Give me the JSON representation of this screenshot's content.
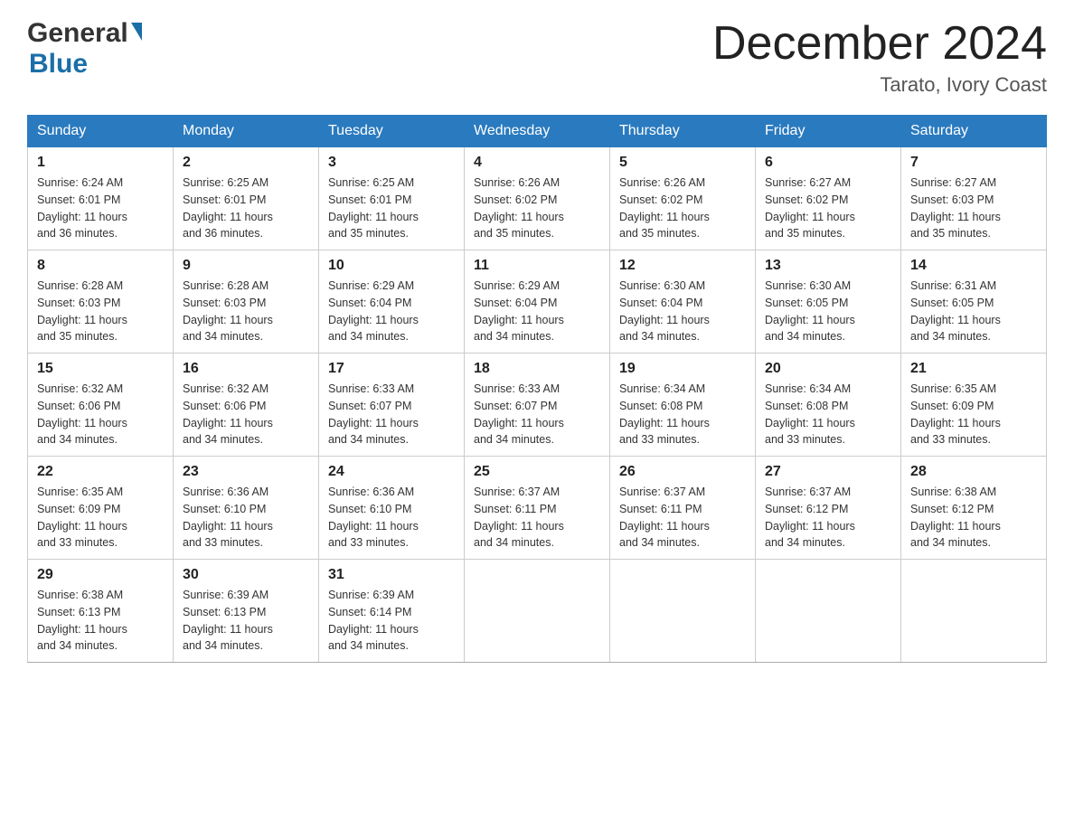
{
  "header": {
    "logo_general": "General",
    "logo_blue": "Blue",
    "month_title": "December 2024",
    "location": "Tarato, Ivory Coast"
  },
  "days_of_week": [
    "Sunday",
    "Monday",
    "Tuesday",
    "Wednesday",
    "Thursday",
    "Friday",
    "Saturday"
  ],
  "weeks": [
    [
      {
        "day": "1",
        "sunrise": "6:24 AM",
        "sunset": "6:01 PM",
        "daylight": "11 hours and 36 minutes."
      },
      {
        "day": "2",
        "sunrise": "6:25 AM",
        "sunset": "6:01 PM",
        "daylight": "11 hours and 36 minutes."
      },
      {
        "day": "3",
        "sunrise": "6:25 AM",
        "sunset": "6:01 PM",
        "daylight": "11 hours and 35 minutes."
      },
      {
        "day": "4",
        "sunrise": "6:26 AM",
        "sunset": "6:02 PM",
        "daylight": "11 hours and 35 minutes."
      },
      {
        "day": "5",
        "sunrise": "6:26 AM",
        "sunset": "6:02 PM",
        "daylight": "11 hours and 35 minutes."
      },
      {
        "day": "6",
        "sunrise": "6:27 AM",
        "sunset": "6:02 PM",
        "daylight": "11 hours and 35 minutes."
      },
      {
        "day": "7",
        "sunrise": "6:27 AM",
        "sunset": "6:03 PM",
        "daylight": "11 hours and 35 minutes."
      }
    ],
    [
      {
        "day": "8",
        "sunrise": "6:28 AM",
        "sunset": "6:03 PM",
        "daylight": "11 hours and 35 minutes."
      },
      {
        "day": "9",
        "sunrise": "6:28 AM",
        "sunset": "6:03 PM",
        "daylight": "11 hours and 34 minutes."
      },
      {
        "day": "10",
        "sunrise": "6:29 AM",
        "sunset": "6:04 PM",
        "daylight": "11 hours and 34 minutes."
      },
      {
        "day": "11",
        "sunrise": "6:29 AM",
        "sunset": "6:04 PM",
        "daylight": "11 hours and 34 minutes."
      },
      {
        "day": "12",
        "sunrise": "6:30 AM",
        "sunset": "6:04 PM",
        "daylight": "11 hours and 34 minutes."
      },
      {
        "day": "13",
        "sunrise": "6:30 AM",
        "sunset": "6:05 PM",
        "daylight": "11 hours and 34 minutes."
      },
      {
        "day": "14",
        "sunrise": "6:31 AM",
        "sunset": "6:05 PM",
        "daylight": "11 hours and 34 minutes."
      }
    ],
    [
      {
        "day": "15",
        "sunrise": "6:32 AM",
        "sunset": "6:06 PM",
        "daylight": "11 hours and 34 minutes."
      },
      {
        "day": "16",
        "sunrise": "6:32 AM",
        "sunset": "6:06 PM",
        "daylight": "11 hours and 34 minutes."
      },
      {
        "day": "17",
        "sunrise": "6:33 AM",
        "sunset": "6:07 PM",
        "daylight": "11 hours and 34 minutes."
      },
      {
        "day": "18",
        "sunrise": "6:33 AM",
        "sunset": "6:07 PM",
        "daylight": "11 hours and 34 minutes."
      },
      {
        "day": "19",
        "sunrise": "6:34 AM",
        "sunset": "6:08 PM",
        "daylight": "11 hours and 33 minutes."
      },
      {
        "day": "20",
        "sunrise": "6:34 AM",
        "sunset": "6:08 PM",
        "daylight": "11 hours and 33 minutes."
      },
      {
        "day": "21",
        "sunrise": "6:35 AM",
        "sunset": "6:09 PM",
        "daylight": "11 hours and 33 minutes."
      }
    ],
    [
      {
        "day": "22",
        "sunrise": "6:35 AM",
        "sunset": "6:09 PM",
        "daylight": "11 hours and 33 minutes."
      },
      {
        "day": "23",
        "sunrise": "6:36 AM",
        "sunset": "6:10 PM",
        "daylight": "11 hours and 33 minutes."
      },
      {
        "day": "24",
        "sunrise": "6:36 AM",
        "sunset": "6:10 PM",
        "daylight": "11 hours and 33 minutes."
      },
      {
        "day": "25",
        "sunrise": "6:37 AM",
        "sunset": "6:11 PM",
        "daylight": "11 hours and 34 minutes."
      },
      {
        "day": "26",
        "sunrise": "6:37 AM",
        "sunset": "6:11 PM",
        "daylight": "11 hours and 34 minutes."
      },
      {
        "day": "27",
        "sunrise": "6:37 AM",
        "sunset": "6:12 PM",
        "daylight": "11 hours and 34 minutes."
      },
      {
        "day": "28",
        "sunrise": "6:38 AM",
        "sunset": "6:12 PM",
        "daylight": "11 hours and 34 minutes."
      }
    ],
    [
      {
        "day": "29",
        "sunrise": "6:38 AM",
        "sunset": "6:13 PM",
        "daylight": "11 hours and 34 minutes."
      },
      {
        "day": "30",
        "sunrise": "6:39 AM",
        "sunset": "6:13 PM",
        "daylight": "11 hours and 34 minutes."
      },
      {
        "day": "31",
        "sunrise": "6:39 AM",
        "sunset": "6:14 PM",
        "daylight": "11 hours and 34 minutes."
      },
      null,
      null,
      null,
      null
    ]
  ],
  "labels": {
    "sunrise": "Sunrise:",
    "sunset": "Sunset:",
    "daylight": "Daylight:"
  }
}
